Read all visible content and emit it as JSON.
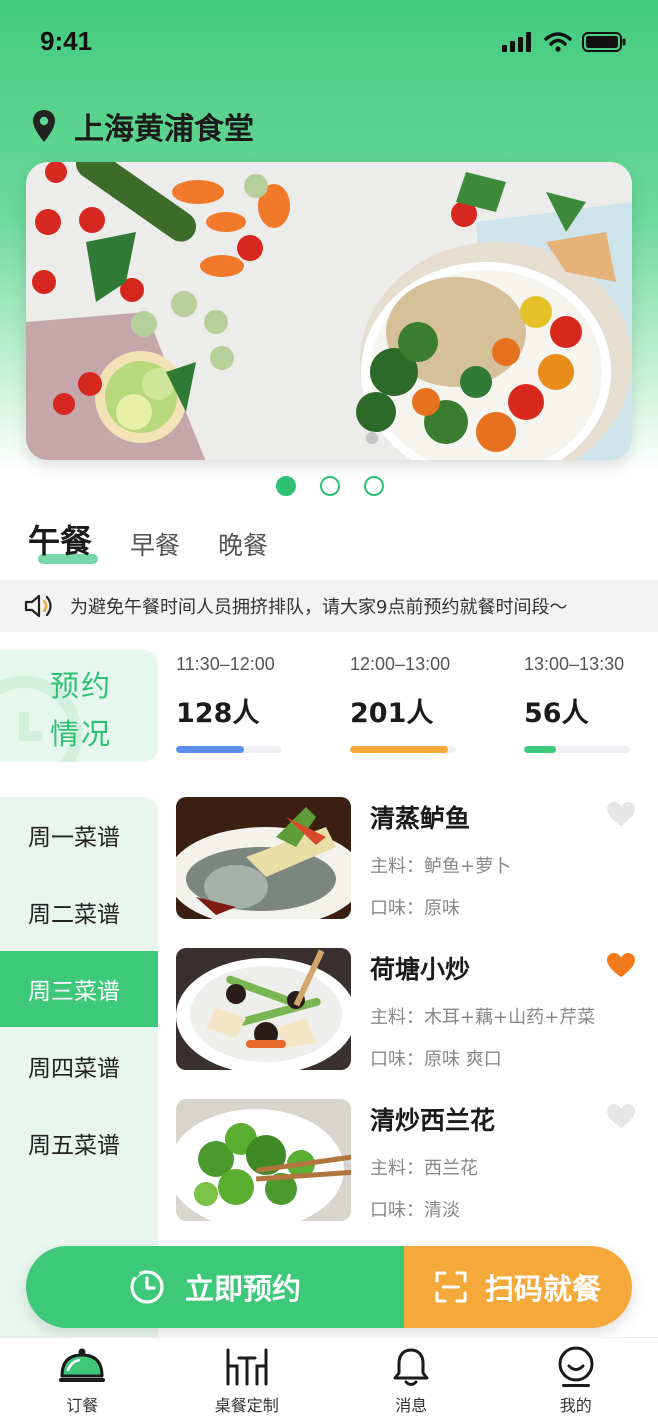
{
  "status_bar": {
    "time": "9:41"
  },
  "location": {
    "name": "上海黄浦食堂"
  },
  "banner": {
    "dots": 3,
    "active_dot": 0
  },
  "meal_tabs": [
    {
      "label": "午餐",
      "active": true
    },
    {
      "label": "早餐",
      "active": false
    },
    {
      "label": "晚餐",
      "active": false
    }
  ],
  "notice": {
    "text": "为避免午餐时间人员拥挤排队，请大家9点前预约就餐时间段～"
  },
  "booking": {
    "title": "预约情况",
    "slots": [
      {
        "time": "11:30–12:00",
        "count": "128人",
        "fill": 0.64,
        "color": "#5b8ef0"
      },
      {
        "time": "12:00–13:00",
        "count": "201人",
        "fill": 0.92,
        "color": "#f4a93a"
      },
      {
        "time": "13:00–13:30",
        "count": "56人",
        "fill": 0.3,
        "color": "#3dc87a"
      }
    ]
  },
  "menu_days": [
    {
      "label": "周一菜谱",
      "active": false
    },
    {
      "label": "周二菜谱",
      "active": false
    },
    {
      "label": "周三菜谱",
      "active": true
    },
    {
      "label": "周四菜谱",
      "active": false
    },
    {
      "label": "周五菜谱",
      "active": false
    }
  ],
  "dishes": [
    {
      "name": "清蒸鲈鱼",
      "main": "主料：鲈鱼+萝卜",
      "taste": "口味：原味",
      "favorite": false
    },
    {
      "name": "荷塘小炒",
      "main": "主料：木耳+藕+山药+芹菜",
      "taste": "口味：原味 爽口",
      "favorite": true
    },
    {
      "name": "清炒西兰花",
      "main": "主料：西兰花",
      "taste": "口味：清淡",
      "favorite": false
    }
  ],
  "actions": {
    "reserve_label": "立即预约",
    "scan_label": "扫码就餐"
  },
  "tabbar": [
    {
      "label": "订餐",
      "icon": "cloche-icon"
    },
    {
      "label": "桌餐定制",
      "icon": "table-dining-icon"
    },
    {
      "label": "消息",
      "icon": "bell-icon"
    },
    {
      "label": "我的",
      "icon": "profile-icon"
    }
  ],
  "colors": {
    "primary": "#3dc87a",
    "accent": "#f4a93a",
    "favorite": "#f27a1a",
    "heart_inactive": "#e4e4e4"
  }
}
